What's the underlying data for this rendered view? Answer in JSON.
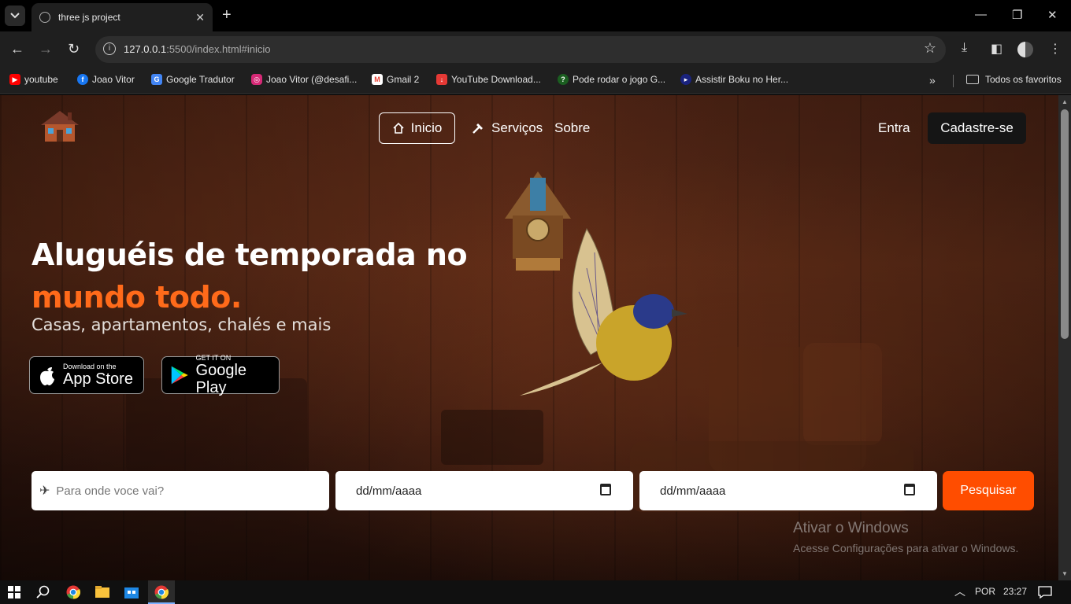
{
  "browser": {
    "tab_title": "three js project",
    "url_host": "127.0.0.1",
    "url_rest": ":5500/index.html#inicio"
  },
  "bookmarks": [
    {
      "label": "youtube",
      "icon": "youtube-icon",
      "color": "#ff0000"
    },
    {
      "label": "Joao Vitor",
      "icon": "facebook-icon",
      "color": "#1877f2"
    },
    {
      "label": "Google Tradutor",
      "icon": "google-translate-icon",
      "color": "#4285f4"
    },
    {
      "label": "Joao Vitor (@desafi...",
      "icon": "instagram-icon",
      "color": "#d62976"
    },
    {
      "label": "Gmail 2",
      "icon": "gmail-icon",
      "color": "#ea4335"
    },
    {
      "label": "YouTube Download...",
      "icon": "download-icon",
      "color": "#e53935"
    },
    {
      "label": "Pode rodar o jogo G...",
      "icon": "game-icon",
      "color": "#1b5e20"
    },
    {
      "label": "Assistir Boku no Her...",
      "icon": "play-icon",
      "color": "#1a237e"
    }
  ],
  "bookmarks_folder": "Todos os favoritos",
  "nav": {
    "inicio": "Inicio",
    "servicos": "Serviços",
    "sobre": "Sobre",
    "entra": "Entra",
    "cadastre": "Cadastre-se"
  },
  "hero": {
    "title_line1": "Aluguéis de temporada no",
    "title_line2": "mundo todo.",
    "subtitle": "Casas, apartamentos, chalés e mais"
  },
  "stores": {
    "apple_small": "Download on the",
    "apple_big": "App Store",
    "google_small": "GET IT ON",
    "google_big": "Google Play"
  },
  "search": {
    "destination_placeholder": "Para onde voce vai?",
    "checkin": "dd/mm/aaaa",
    "checkout": "dd/mm/aaaa",
    "button": "Pesquisar"
  },
  "watermark": {
    "title": "Ativar o Windows",
    "subtitle": "Acesse Configurações para ativar o Windows."
  },
  "taskbar": {
    "language": "POR",
    "time": "23:27"
  },
  "colors": {
    "accent": "#ff6a1a",
    "search_button": "#ff4d00"
  }
}
